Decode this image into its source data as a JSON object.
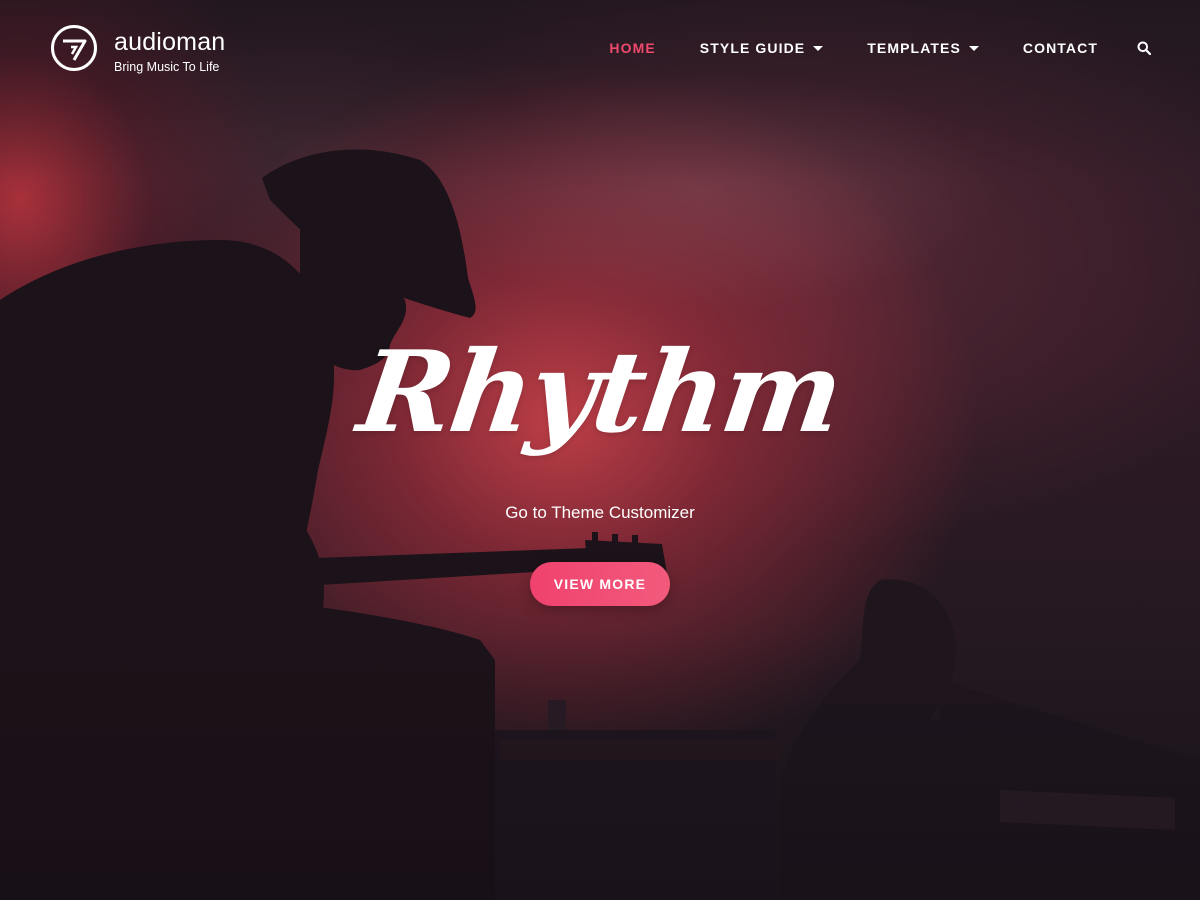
{
  "site": {
    "title": "audioman",
    "tagline": "Bring Music To Life",
    "logo_icon": "circle-v-logo-icon"
  },
  "nav": {
    "items": [
      {
        "label": "HOME",
        "active": true,
        "has_dropdown": false
      },
      {
        "label": "STYLE GUIDE",
        "active": false,
        "has_dropdown": true
      },
      {
        "label": "TEMPLATES",
        "active": false,
        "has_dropdown": true
      },
      {
        "label": "CONTACT",
        "active": false,
        "has_dropdown": false
      }
    ],
    "search_icon": "search-icon"
  },
  "hero": {
    "title": "Rhythm",
    "subtitle": "Go to Theme Customizer",
    "button_label": "VIEW MORE",
    "background": "silhouette of guitarist and keyboard player on red-lit stage"
  },
  "colors": {
    "accent": "#ef4a6d",
    "button_gradient_start": "#f0426e",
    "button_gradient_end": "#f25a7c",
    "text": "#ffffff",
    "background_dark": "#1e171d",
    "stage_red": "#c44048"
  }
}
